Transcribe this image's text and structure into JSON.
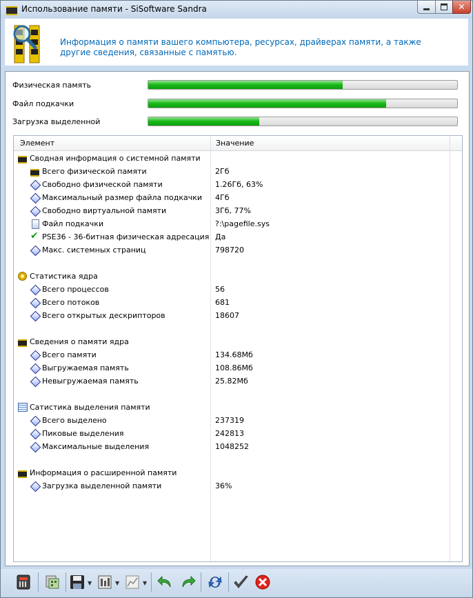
{
  "window": {
    "title": "Использование памяти - SiSoftware Sandra",
    "controls": [
      "minimize",
      "maximize",
      "close"
    ],
    "close_glyph": "✕"
  },
  "header": {
    "description": "Информация о памяти вашего компьютера, ресурсах, драйверах памяти, а также другие сведения, связанные с памятью.",
    "icon": "memory-magnifier-icon"
  },
  "bars": [
    {
      "label": "Физическая память",
      "fill_fraction": 0.63
    },
    {
      "label": "Файл подкачки",
      "fill_fraction": 0.77
    },
    {
      "label": "Загрузка выделенной",
      "fill_fraction": 0.36
    }
  ],
  "table": {
    "columns": [
      "Элемент",
      "Значение"
    ],
    "groups": [
      {
        "label": "Сводная информация о системной памяти",
        "icon": "memory-chip-icon",
        "items": [
          {
            "name": "Всего физической памяти",
            "value": "2Гб",
            "icon": "memory-chip-icon"
          },
          {
            "name": "Свободно физической памяти",
            "value": "1.26Гб, 63%",
            "icon": "diamond-icon"
          },
          {
            "name": "Максимальный размер файла подкачки",
            "value": "4Гб",
            "icon": "diamond-icon"
          },
          {
            "name": "Свободно виртуальной памяти",
            "value": "3Гб, 77%",
            "icon": "diamond-icon"
          },
          {
            "name": "Файл подкачки",
            "value": "?:\\pagefile.sys",
            "icon": "file-icon"
          },
          {
            "name": "PSE36 - 36-битная физическая адресация",
            "value": "Да",
            "icon": "check-icon"
          },
          {
            "name": "Макс. системных страниц",
            "value": "798720",
            "icon": "diamond-icon"
          }
        ]
      },
      {
        "label": "Статистика ядра",
        "icon": "gear-icon",
        "items": [
          {
            "name": "Всего процессов",
            "value": "56",
            "icon": "diamond-icon"
          },
          {
            "name": "Всего потоков",
            "value": "681",
            "icon": "diamond-icon"
          },
          {
            "name": "Всего открытых дескрипторов",
            "value": "18607",
            "icon": "diamond-icon"
          }
        ]
      },
      {
        "label": "Сведения о памяти ядра",
        "icon": "memory-chip-icon",
        "items": [
          {
            "name": "Всего памяти",
            "value": "134.68Мб",
            "icon": "diamond-icon"
          },
          {
            "name": "Выгружаемая память",
            "value": "108.86Мб",
            "icon": "diamond-icon"
          },
          {
            "name": "Невыгружаемая память",
            "value": "25.82Мб",
            "icon": "diamond-icon"
          }
        ]
      },
      {
        "label": "Сатистика выделения памяти",
        "icon": "table-icon",
        "items": [
          {
            "name": "Всего выделено",
            "value": "237319",
            "icon": "diamond-icon"
          },
          {
            "name": "Пиковые выделения",
            "value": "242813",
            "icon": "diamond-icon"
          },
          {
            "name": "Максимальные выделения",
            "value": "1048252",
            "icon": "diamond-icon"
          }
        ]
      },
      {
        "label": "Информация о расширенной памяти",
        "icon": "memory-chip-icon",
        "items": [
          {
            "name": "Загрузка выделенной памяти",
            "value": "36%",
            "icon": "diamond-icon"
          }
        ]
      }
    ]
  },
  "toolbar": {
    "buttons": [
      "hardware-icon",
      "report-icon",
      "save-icon",
      "options-icon",
      "chart-icon",
      "back-icon",
      "forward-icon",
      "refresh-icon",
      "ok-icon",
      "cancel-icon"
    ]
  },
  "colors": {
    "accent_text": "#0068b8",
    "bar_fill": "#18b818",
    "window_frame": "#c9dbee"
  }
}
